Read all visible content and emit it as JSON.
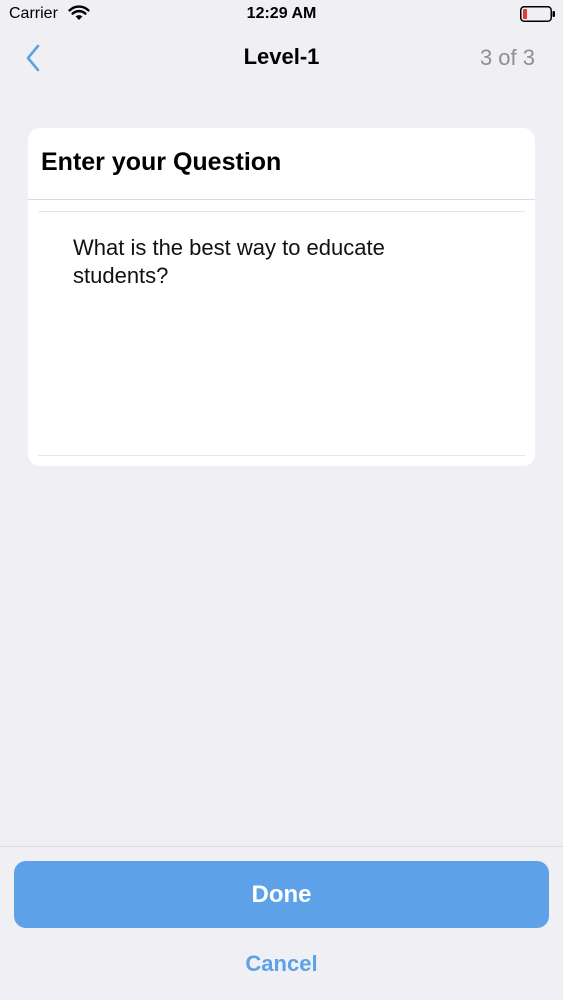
{
  "status_bar": {
    "carrier": "Carrier",
    "time": "12:29 AM"
  },
  "nav": {
    "title": "Level-1",
    "progress": "3 of 3"
  },
  "card": {
    "title": "Enter your Question",
    "question_value": "What is the best way to educate students?"
  },
  "actions": {
    "done_label": "Done",
    "cancel_label": "Cancel"
  },
  "colors": {
    "accent": "#5da2e8",
    "background": "#efeff4",
    "battery_low": "#e53935"
  },
  "icons": {
    "wifi": "wifi-icon",
    "battery": "battery-icon",
    "back": "chevron-left-icon"
  }
}
